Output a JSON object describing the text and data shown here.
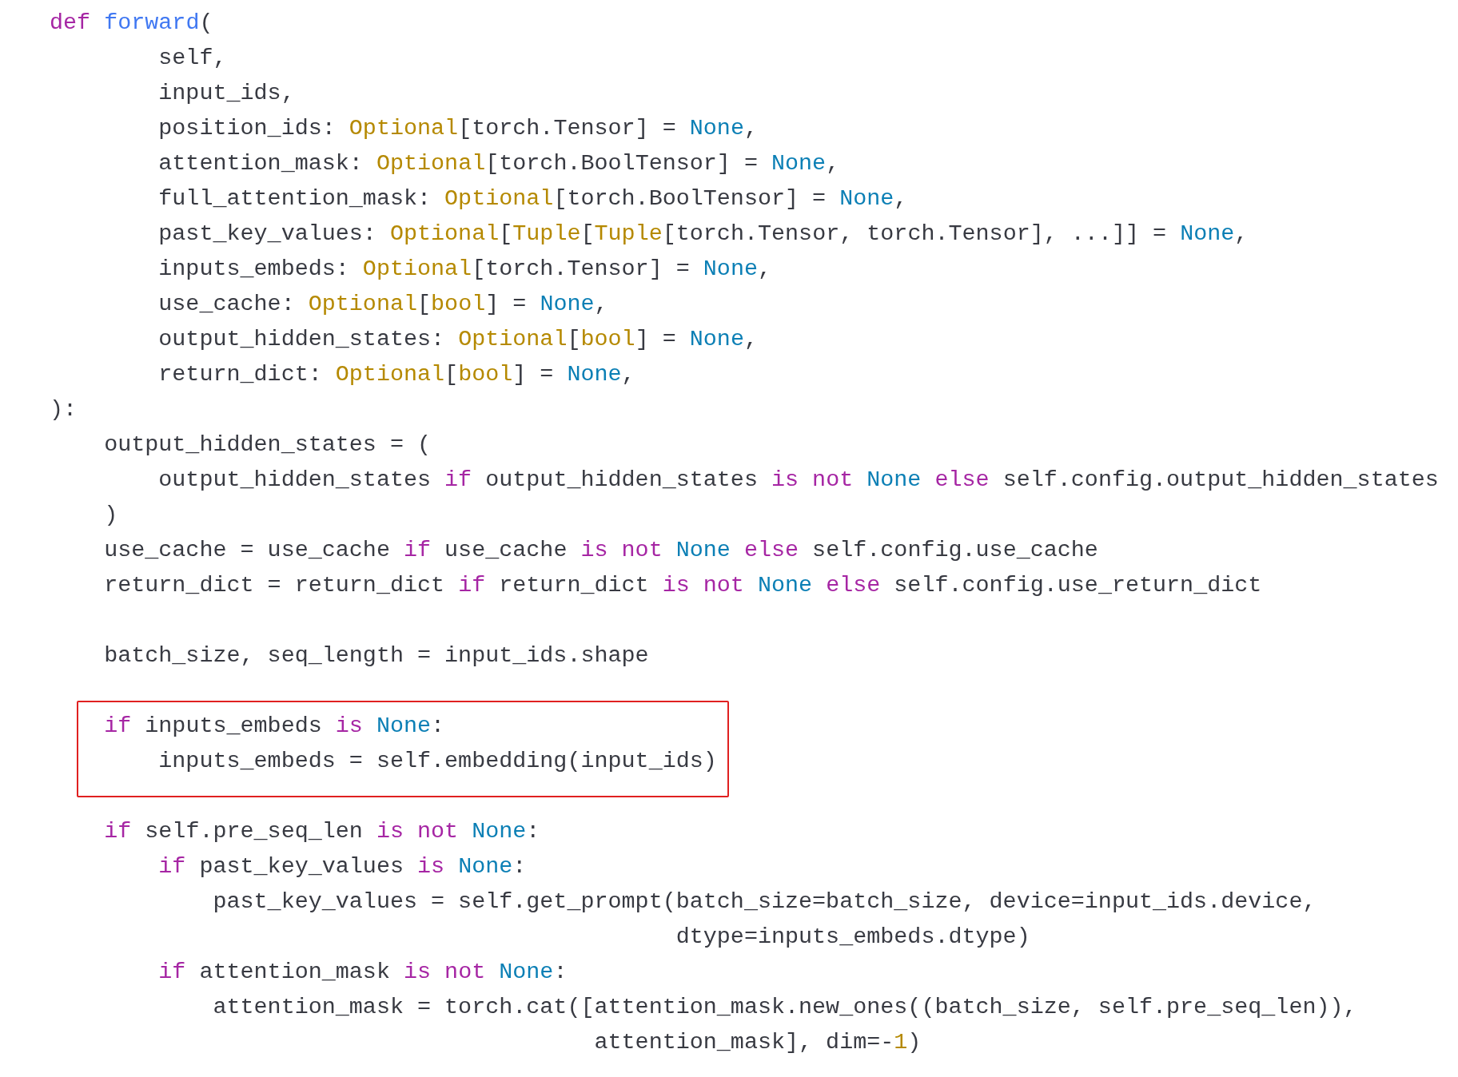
{
  "code": {
    "segments": [
      {
        "kind": "plain",
        "lines": [
          [
            {
              "kind": "keyword",
              "text": "def "
            },
            {
              "kind": "function",
              "text": "forward"
            },
            {
              "kind": "plain",
              "text": "("
            }
          ],
          [
            {
              "kind": "plain",
              "text": "        self,"
            }
          ],
          [
            {
              "kind": "plain",
              "text": "        input_ids,"
            }
          ],
          [
            {
              "kind": "plain",
              "text": "        position_ids: "
            },
            {
              "kind": "type",
              "text": "Optional"
            },
            {
              "kind": "plain",
              "text": "[torch.Tensor] = "
            },
            {
              "kind": "constant",
              "text": "None"
            },
            {
              "kind": "plain",
              "text": ","
            }
          ],
          [
            {
              "kind": "plain",
              "text": "        attention_mask: "
            },
            {
              "kind": "type",
              "text": "Optional"
            },
            {
              "kind": "plain",
              "text": "[torch.BoolTensor] = "
            },
            {
              "kind": "constant",
              "text": "None"
            },
            {
              "kind": "plain",
              "text": ","
            }
          ],
          [
            {
              "kind": "plain",
              "text": "        full_attention_mask: "
            },
            {
              "kind": "type",
              "text": "Optional"
            },
            {
              "kind": "plain",
              "text": "[torch.BoolTensor] = "
            },
            {
              "kind": "constant",
              "text": "None"
            },
            {
              "kind": "plain",
              "text": ","
            }
          ],
          [
            {
              "kind": "plain",
              "text": "        past_key_values: "
            },
            {
              "kind": "type",
              "text": "Optional"
            },
            {
              "kind": "plain",
              "text": "["
            },
            {
              "kind": "type",
              "text": "Tuple"
            },
            {
              "kind": "plain",
              "text": "["
            },
            {
              "kind": "type",
              "text": "Tuple"
            },
            {
              "kind": "plain",
              "text": "[torch.Tensor, torch.Tensor], ...]] = "
            },
            {
              "kind": "constant",
              "text": "None"
            },
            {
              "kind": "plain",
              "text": ","
            }
          ],
          [
            {
              "kind": "plain",
              "text": "        inputs_embeds: "
            },
            {
              "kind": "type",
              "text": "Optional"
            },
            {
              "kind": "plain",
              "text": "[torch.Tensor] = "
            },
            {
              "kind": "constant",
              "text": "None"
            },
            {
              "kind": "plain",
              "text": ","
            }
          ],
          [
            {
              "kind": "plain",
              "text": "        use_cache: "
            },
            {
              "kind": "type",
              "text": "Optional"
            },
            {
              "kind": "plain",
              "text": "["
            },
            {
              "kind": "type",
              "text": "bool"
            },
            {
              "kind": "plain",
              "text": "] = "
            },
            {
              "kind": "constant",
              "text": "None"
            },
            {
              "kind": "plain",
              "text": ","
            }
          ],
          [
            {
              "kind": "plain",
              "text": "        output_hidden_states: "
            },
            {
              "kind": "type",
              "text": "Optional"
            },
            {
              "kind": "plain",
              "text": "["
            },
            {
              "kind": "type",
              "text": "bool"
            },
            {
              "kind": "plain",
              "text": "] = "
            },
            {
              "kind": "constant",
              "text": "None"
            },
            {
              "kind": "plain",
              "text": ","
            }
          ],
          [
            {
              "kind": "plain",
              "text": "        return_dict: "
            },
            {
              "kind": "type",
              "text": "Optional"
            },
            {
              "kind": "plain",
              "text": "["
            },
            {
              "kind": "type",
              "text": "bool"
            },
            {
              "kind": "plain",
              "text": "] = "
            },
            {
              "kind": "constant",
              "text": "None"
            },
            {
              "kind": "plain",
              "text": ","
            }
          ],
          [
            {
              "kind": "plain",
              "text": "):"
            }
          ],
          [
            {
              "kind": "plain",
              "text": "    output_hidden_states = ("
            }
          ],
          [
            {
              "kind": "plain",
              "text": "        output_hidden_states "
            },
            {
              "kind": "keyword",
              "text": "if"
            },
            {
              "kind": "plain",
              "text": " output_hidden_states "
            },
            {
              "kind": "keyword",
              "text": "is not "
            },
            {
              "kind": "constant",
              "text": "None"
            },
            {
              "kind": "keyword",
              "text": " else"
            },
            {
              "kind": "plain",
              "text": " self.config.output_hidden_states"
            }
          ],
          [
            {
              "kind": "plain",
              "text": "    )"
            }
          ],
          [
            {
              "kind": "plain",
              "text": "    use_cache = use_cache "
            },
            {
              "kind": "keyword",
              "text": "if"
            },
            {
              "kind": "plain",
              "text": " use_cache "
            },
            {
              "kind": "keyword",
              "text": "is not "
            },
            {
              "kind": "constant",
              "text": "None"
            },
            {
              "kind": "keyword",
              "text": " else"
            },
            {
              "kind": "plain",
              "text": " self.config.use_cache"
            }
          ],
          [
            {
              "kind": "plain",
              "text": "    return_dict = return_dict "
            },
            {
              "kind": "keyword",
              "text": "if"
            },
            {
              "kind": "plain",
              "text": " return_dict "
            },
            {
              "kind": "keyword",
              "text": "is not "
            },
            {
              "kind": "constant",
              "text": "None"
            },
            {
              "kind": "keyword",
              "text": " else"
            },
            {
              "kind": "plain",
              "text": " self.config.use_return_dict"
            }
          ]
        ]
      },
      {
        "kind": "plain",
        "lines": [
          [
            {
              "kind": "plain",
              "text": "    batch_size, seq_length = input_ids.shape"
            }
          ]
        ]
      },
      {
        "kind": "highlight",
        "lines": [
          [
            {
              "kind": "keyword",
              "text": "    if"
            },
            {
              "kind": "plain",
              "text": " inputs_embeds "
            },
            {
              "kind": "keyword",
              "text": "is "
            },
            {
              "kind": "constant",
              "text": "None"
            },
            {
              "kind": "plain",
              "text": ":"
            }
          ],
          [
            {
              "kind": "plain",
              "text": "        inputs_embeds = self.embedding(input_ids)"
            }
          ]
        ]
      },
      {
        "kind": "plain",
        "lines": [
          [
            {
              "kind": "keyword",
              "text": "    if"
            },
            {
              "kind": "plain",
              "text": " self.pre_seq_len "
            },
            {
              "kind": "keyword",
              "text": "is not "
            },
            {
              "kind": "constant",
              "text": "None"
            },
            {
              "kind": "plain",
              "text": ":"
            }
          ],
          [
            {
              "kind": "keyword",
              "text": "        if"
            },
            {
              "kind": "plain",
              "text": " past_key_values "
            },
            {
              "kind": "keyword",
              "text": "is "
            },
            {
              "kind": "constant",
              "text": "None"
            },
            {
              "kind": "plain",
              "text": ":"
            }
          ],
          [
            {
              "kind": "plain",
              "text": "            past_key_values = self.get_prompt(batch_size=batch_size, device=input_ids.device,"
            }
          ],
          [
            {
              "kind": "plain",
              "text": "                                              dtype=inputs_embeds.dtype)"
            }
          ],
          [
            {
              "kind": "keyword",
              "text": "        if"
            },
            {
              "kind": "plain",
              "text": " attention_mask "
            },
            {
              "kind": "keyword",
              "text": "is not "
            },
            {
              "kind": "constant",
              "text": "None"
            },
            {
              "kind": "plain",
              "text": ":"
            }
          ],
          [
            {
              "kind": "plain",
              "text": "            attention_mask = torch.cat([attention_mask.new_ones((batch_size, self.pre_seq_len)),"
            }
          ],
          [
            {
              "kind": "plain",
              "text": "                                        attention_mask], dim=-"
            },
            {
              "kind": "number",
              "text": "1"
            },
            {
              "kind": "plain",
              "text": ")"
            }
          ]
        ]
      }
    ]
  }
}
